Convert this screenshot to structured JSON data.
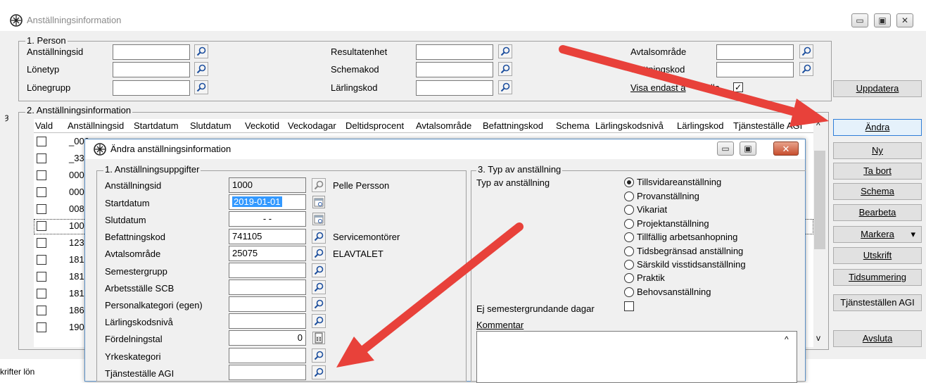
{
  "window": {
    "title": "Anställningsinformation",
    "ctrl_min": "▭",
    "ctrl_max": "▣",
    "ctrl_close": "✕"
  },
  "person_group": {
    "label": "1. Person",
    "fields": [
      {
        "label": "Anställningsid",
        "value": ""
      },
      {
        "label": "Lönetyp",
        "value": ""
      },
      {
        "label": "Lönegrupp",
        "value": ""
      },
      {
        "label": "Resultatenhet",
        "value": ""
      },
      {
        "label": "Schemakod",
        "value": ""
      },
      {
        "label": "Lärlingskod",
        "value": ""
      },
      {
        "label": "Avtalsområde",
        "value": ""
      },
      {
        "label": "efattningskod",
        "value": ""
      }
    ],
    "visa_label": "Visa endast a",
    "visa_tail": "lla",
    "visa_checked": "✓"
  },
  "buttons": {
    "uppdatera": "Uppdatera",
    "andra": "Ändra",
    "ny": "Ny",
    "ta_bort": "Ta bort",
    "schema": "Schema",
    "bearbeta": "Bearbeta",
    "markera": "Markera",
    "markera_arrow": "▾",
    "utskrift": "Utskrift",
    "tidsummering": "Tidsummering",
    "tjanstestallen": "Tjänsteställen AGI",
    "avsluta": "Avsluta"
  },
  "grid": {
    "group_label": "2. Anställningsinformation",
    "columns": [
      "Vald",
      "Anställningsid",
      "Startdatum",
      "Slutdatum",
      "Veckotid",
      "Veckodagar",
      "Deltidsprocent",
      "Avtalsområde",
      "Befattningskod",
      "Schema",
      "Lärlingskodsnivå",
      "Lärlingskod",
      "Tjänsteställe AGI"
    ],
    "rows": [
      "_000",
      "_333",
      "0000",
      "0001",
      "008",
      "1000",
      "1234",
      "1819",
      "1819",
      "1819",
      "186",
      "190"
    ],
    "scroll_up": "^",
    "scroll_down": "v"
  },
  "status_left": "krifter lön",
  "dialog": {
    "title": "Ändra anställningsinformation",
    "group1_label": "1. Anställningsuppgifter",
    "fields": [
      {
        "label": "Anställningsid",
        "value": "1000",
        "extra": "Pelle Persson"
      },
      {
        "label": "Startdatum",
        "value": "2019-01-01",
        "extra": ""
      },
      {
        "label": "Slutdatum",
        "value": "- -",
        "extra": ""
      },
      {
        "label": "Befattningskod",
        "value": "741105",
        "extra": "Servicemontörer"
      },
      {
        "label": "Avtalsområde",
        "value": "25075",
        "extra": "ELAVTALET"
      },
      {
        "label": "Semestergrupp",
        "value": "",
        "extra": ""
      },
      {
        "label": "Arbetsställe SCB",
        "value": "",
        "extra": ""
      },
      {
        "label": "Personalkategori (egen)",
        "value": "",
        "extra": ""
      },
      {
        "label": "Lärlingskodsnivå",
        "value": "",
        "extra": ""
      },
      {
        "label": "Fördelningstal",
        "value": "0",
        "extra": ""
      },
      {
        "label": "Yrkeskategori",
        "value": "",
        "extra": ""
      },
      {
        "label": "Tjänsteställe AGI",
        "value": "",
        "extra": ""
      }
    ],
    "group3_label": "3. Typ av anställning",
    "typ_label": "Typ av anställning",
    "typ_options": [
      "Tillsvidareanställning",
      "Provanställning",
      "Vikariat",
      "Projektanställning",
      "Tillfällig arbetsanhopning",
      "Tidsbegränsad anställning",
      "Särskild visstidsanställning",
      "Praktik",
      "Behovsanställning"
    ],
    "typ_selected_index": 0,
    "ej_label": "Ej semestergrundande dagar",
    "kommentar_label": "Kommentar",
    "kommentar_value": "",
    "scroll_up": "^"
  },
  "colors": {
    "arrow": "#e8413a",
    "accent_border": "#2f7ed8",
    "highlight": "#3399ff",
    "close_red": "#c74e2e"
  }
}
